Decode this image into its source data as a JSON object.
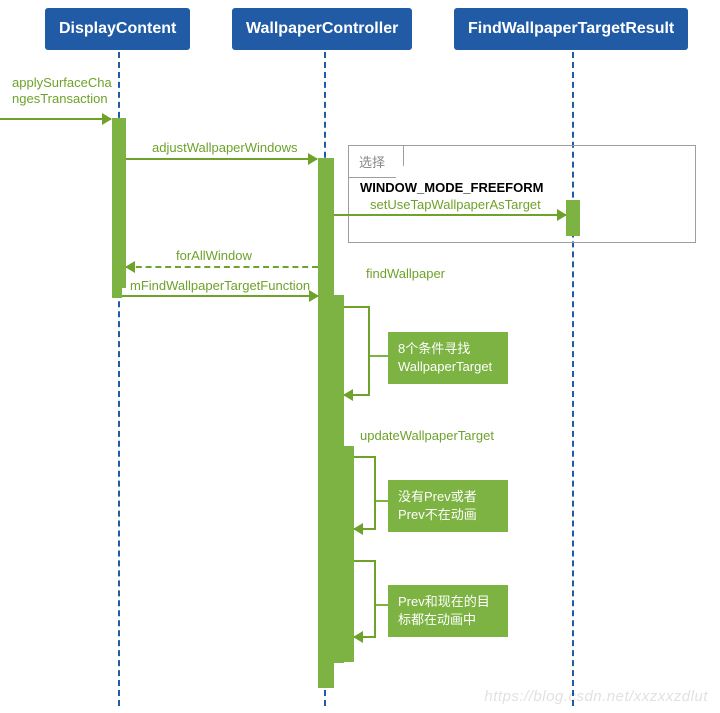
{
  "participants": {
    "display": "DisplayContent",
    "controller": "WallpaperController",
    "result": "FindWallpaperTargetResult"
  },
  "messages": {
    "apply_line1": "applySurfaceCha",
    "apply_line2": "ngesTransaction",
    "adjust": "adjustWallpaperWindows",
    "forall": "forAllWindow",
    "findfunc": "mFindWallpaperTargetFunction",
    "findwp": "findWallpaper",
    "updatewp": "updateWallpaperTarget",
    "setusetap": "setUseTapWallpaperAsTarget"
  },
  "fragment": {
    "label": "选择",
    "guard": "WINDOW_MODE_FREEFORM"
  },
  "notes": {
    "note1_l1": "8个条件寻找",
    "note1_l2": "WallpaperTarget",
    "note2_l1": "没有Prev或者",
    "note2_l2": "Prev不在动画",
    "note3_l1": "Prev和现在的目",
    "note3_l2": "标都在动画中"
  },
  "watermark": "https://blog.csdn.net/xxzxxzdlut"
}
